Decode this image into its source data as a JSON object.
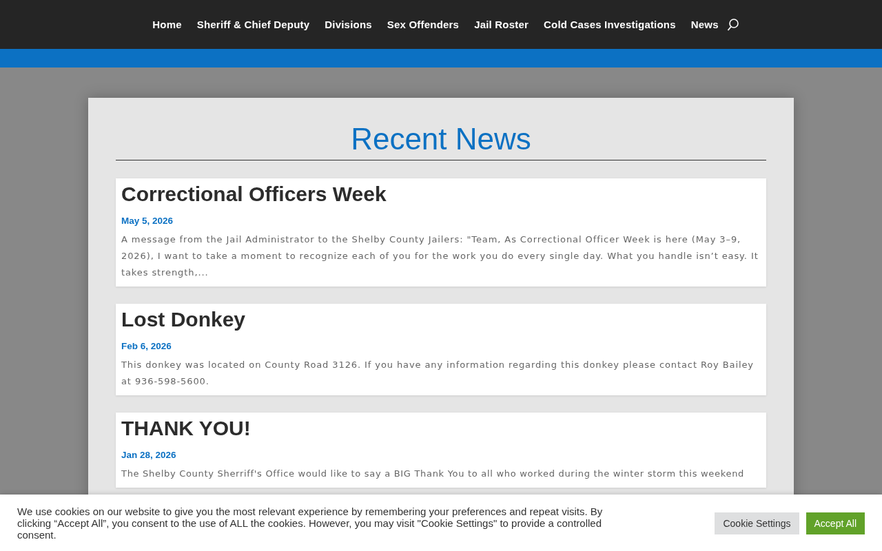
{
  "nav": {
    "items": [
      "Home",
      "Sheriff & Chief Deputy",
      "Divisions",
      "Sex Offenders",
      "Jail Roster",
      "Cold Cases Investigations",
      "News"
    ]
  },
  "section": {
    "title": "Recent News"
  },
  "posts": [
    {
      "title": "Correctional Officers Week",
      "date": "May 5, 2026",
      "excerpt": "A message from the Jail Administrator to the Shelby County Jailers: \"Team, As Correctional Officer Week is here (May 3–9, 2026), I want to take a moment to recognize each of you for the work you do every single day. What you handle isn’t easy. It takes strength,..."
    },
    {
      "title": "Lost Donkey",
      "date": "Feb 6, 2026",
      "excerpt": "This donkey was located on County Road 3126. If you have any information regarding this donkey please contact Roy Bailey at 936-598-5600."
    },
    {
      "title": "THANK YOU!",
      "date": "Jan 28, 2026",
      "excerpt": "The Shelby County Sherriff's Office would like to say a BIG Thank You to all who worked during the winter storm this weekend"
    }
  ],
  "cookie_banner": {
    "text": "We use cookies on our website to give you the most relevant experience by remembering your preferences and repeat visits. By clicking “Accept All”, you consent to the use of ALL the cookies. However, you may visit \"Cookie Settings\" to provide a controlled consent.",
    "buttons": [
      {
        "label": "Cookie Settings",
        "kind": "secondary"
      },
      {
        "label": "Accept All",
        "kind": "primary"
      }
    ]
  }
}
